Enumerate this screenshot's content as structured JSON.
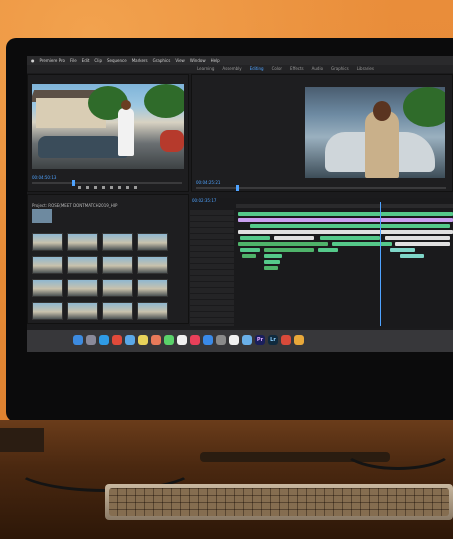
{
  "scene": {
    "description_colors": {
      "wall": "#e98d3a",
      "desk": "#4a2810",
      "bezel": "#0b0b0c",
      "accent": "#4fa3ff"
    }
  },
  "app": {
    "menu": [
      "Premiere Pro",
      "File",
      "Edit",
      "Clip",
      "Sequence",
      "Markers",
      "Graphics",
      "View",
      "Window",
      "Help"
    ],
    "workspaces": [
      "Learning",
      "Assembly",
      "Editing",
      "Color",
      "Effects",
      "Audio",
      "Graphics",
      "Libraries",
      "Editing"
    ],
    "active_workspace_index": 2,
    "source_timecode": "00:04:50:13",
    "program_timecode": "00:04:25:21",
    "timeline_timecode": "00:02:35:17",
    "project_name": "Project: ROSE(MEET DONTMATCH2019_HIP",
    "dock_apps": [
      {
        "icon": "finder-icon",
        "color": "#3d8be0"
      },
      {
        "icon": "launchpad-icon",
        "color": "#8a8a9a"
      },
      {
        "icon": "safari-icon",
        "color": "#2f9be6"
      },
      {
        "icon": "chrome-icon",
        "color": "#e04a3a"
      },
      {
        "icon": "mail-icon",
        "color": "#5aa8e8"
      },
      {
        "icon": "notes-icon",
        "color": "#e8d25a"
      },
      {
        "icon": "photos-icon",
        "color": "#e87a5a"
      },
      {
        "icon": "messages-icon",
        "color": "#5ad26a"
      },
      {
        "icon": "calendar-icon",
        "color": "#f0f0f0"
      },
      {
        "icon": "music-icon",
        "color": "#e8405a"
      },
      {
        "icon": "appstore-icon",
        "color": "#3a8ae8"
      },
      {
        "icon": "settings-icon",
        "color": "#8a8a8a"
      },
      {
        "icon": "notion-icon",
        "color": "#f0f0f0"
      },
      {
        "icon": "files-icon",
        "color": "#6ab0e8"
      },
      {
        "icon": "premiere-icon",
        "label": "Pr",
        "color": "#1a1f5c"
      },
      {
        "icon": "lightroom-icon",
        "label": "Lr",
        "color": "#0f2a3e"
      },
      {
        "icon": "photoshop-icon",
        "color": "#d84a3a"
      },
      {
        "icon": "sketch-icon",
        "color": "#e8a83a"
      }
    ],
    "clip_colors": [
      "#7fd6c8",
      "#55c98a",
      "#b48ae6",
      "#e0e0e0",
      "#c9a0f0",
      "#4fb36a"
    ]
  }
}
